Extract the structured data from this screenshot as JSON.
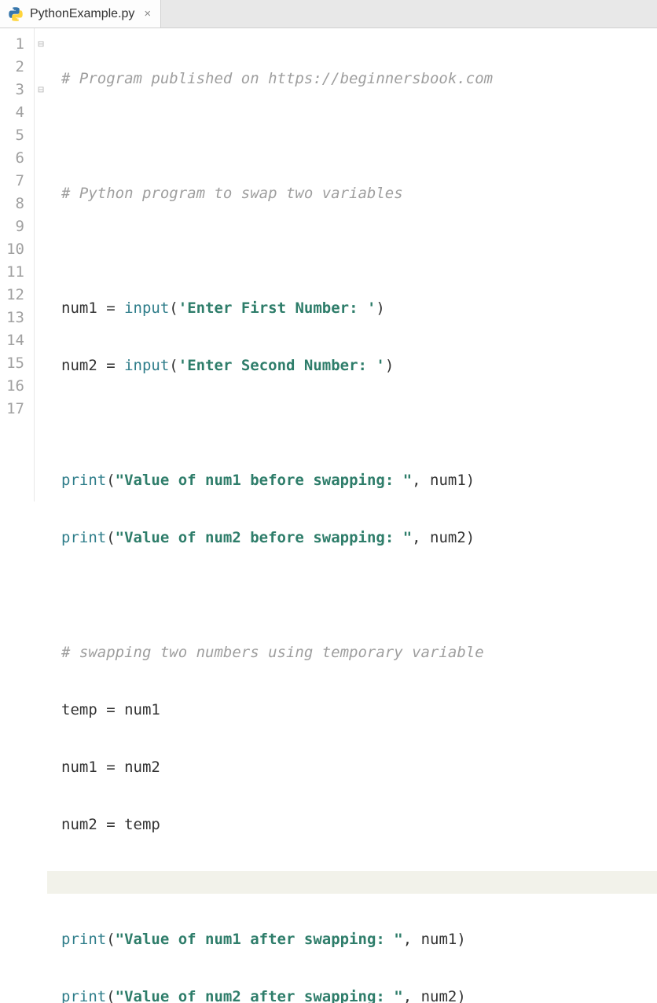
{
  "tab": {
    "filename": "PythonExample.py",
    "icon": "python-file-icon",
    "close": "×"
  },
  "gutter": {
    "lines": [
      "1",
      "2",
      "3",
      "4",
      "5",
      "6",
      "7",
      "8",
      "9",
      "10",
      "11",
      "12",
      "13",
      "14",
      "15",
      "16",
      "17"
    ]
  },
  "fold": {
    "line1": "⊟",
    "line3": "⊟"
  },
  "code": {
    "l1_comment": "# Program published on https://beginnersbook.com",
    "l3_comment": "# Python program to swap two variables",
    "l5_ident": "num1 ",
    "l5_eq": "= ",
    "l5_func": "input",
    "l5_paren_o": "(",
    "l5_str": "'Enter First Number: '",
    "l5_paren_c": ")",
    "l6_ident": "num2 ",
    "l6_eq": "= ",
    "l6_func": "input",
    "l6_paren_o": "(",
    "l6_str": "'Enter Second Number: '",
    "l6_paren_c": ")",
    "l8_func": "print",
    "l8_paren_o": "(",
    "l8_str": "\"Value of num1 before swapping: \"",
    "l8_comma_arg": ", num1)",
    "l9_func": "print",
    "l9_paren_o": "(",
    "l9_str": "\"Value of num2 before swapping: \"",
    "l9_comma_arg": ", num2)",
    "l11_comment": "# swapping two numbers using temporary variable",
    "l12": "temp = num1",
    "l13": "num1 = num2",
    "l14": "num2 = temp",
    "l16_func": "print",
    "l16_paren_o": "(",
    "l16_str": "\"Value of num1 after swapping: \"",
    "l16_comma_arg": ", num1)",
    "l17_func": "print",
    "l17_paren_o": "(",
    "l17_str": "\"Value of num2 after swapping: \"",
    "l17_comma_arg": ", num2)"
  }
}
